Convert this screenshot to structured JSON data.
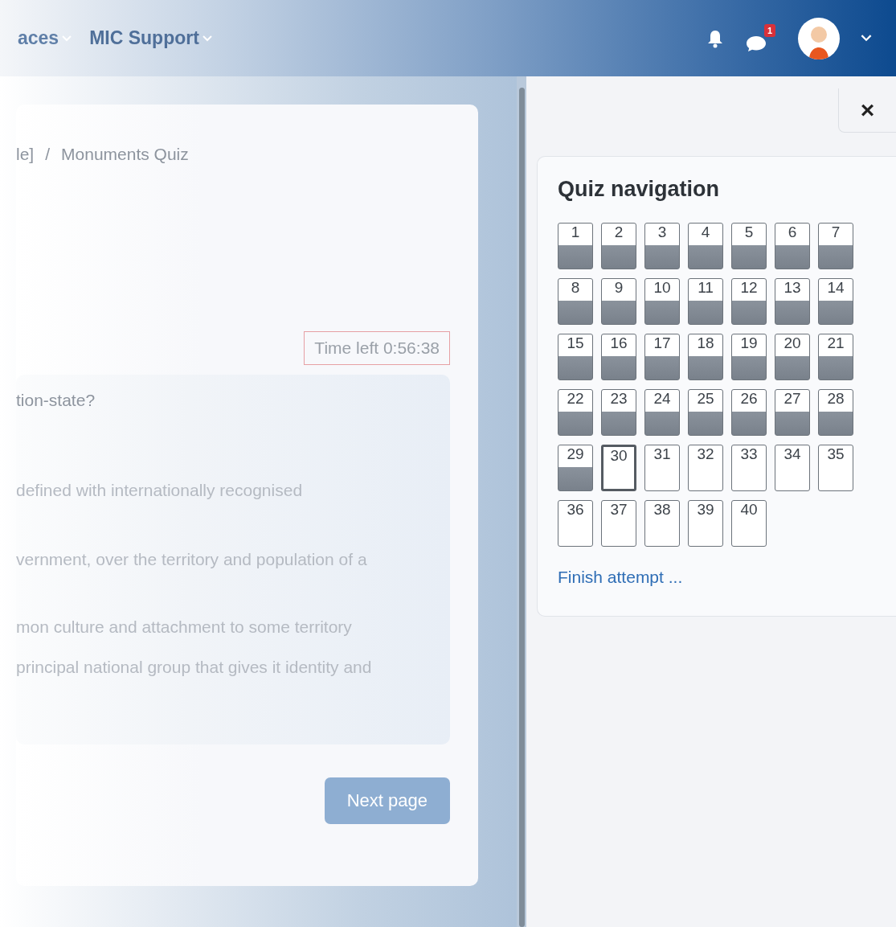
{
  "navbar": {
    "menus": [
      {
        "label": "aces"
      },
      {
        "label": "MIC Support"
      }
    ],
    "message_badge": "1"
  },
  "breadcrumb": {
    "items": [
      "le]",
      "Monuments Quiz"
    ],
    "separator": "/"
  },
  "timer": "Time left 0:56:38",
  "question": {
    "text": "tion-state?",
    "options": [
      "defined with internationally recognised",
      "vernment, over the territory and population of a",
      "mon culture and attachment to some territory",
      "principal national group that gives it identity and"
    ]
  },
  "next_button": "Next page",
  "drawer": {
    "close": "×",
    "title": "Quiz navigation",
    "finish_link": "Finish attempt ...",
    "questions": [
      {
        "label": "1",
        "answered": true,
        "current": false
      },
      {
        "label": "2",
        "answered": true,
        "current": false
      },
      {
        "label": "3",
        "answered": true,
        "current": false
      },
      {
        "label": "4",
        "answered": true,
        "current": false
      },
      {
        "label": "5",
        "answered": true,
        "current": false
      },
      {
        "label": "6",
        "answered": true,
        "current": false
      },
      {
        "label": "7",
        "answered": true,
        "current": false
      },
      {
        "label": "8",
        "answered": true,
        "current": false
      },
      {
        "label": "9",
        "answered": true,
        "current": false
      },
      {
        "label": "10",
        "answered": true,
        "current": false
      },
      {
        "label": "11",
        "answered": true,
        "current": false
      },
      {
        "label": "12",
        "answered": true,
        "current": false
      },
      {
        "label": "13",
        "answered": true,
        "current": false
      },
      {
        "label": "14",
        "answered": true,
        "current": false
      },
      {
        "label": "15",
        "answered": true,
        "current": false
      },
      {
        "label": "16",
        "answered": true,
        "current": false
      },
      {
        "label": "17",
        "answered": true,
        "current": false
      },
      {
        "label": "18",
        "answered": true,
        "current": false
      },
      {
        "label": "19",
        "answered": true,
        "current": false
      },
      {
        "label": "20",
        "answered": true,
        "current": false
      },
      {
        "label": "21",
        "answered": true,
        "current": false
      },
      {
        "label": "22",
        "answered": true,
        "current": false
      },
      {
        "label": "23",
        "answered": true,
        "current": false
      },
      {
        "label": "24",
        "answered": true,
        "current": false
      },
      {
        "label": "25",
        "answered": true,
        "current": false
      },
      {
        "label": "26",
        "answered": true,
        "current": false
      },
      {
        "label": "27",
        "answered": true,
        "current": false
      },
      {
        "label": "28",
        "answered": true,
        "current": false
      },
      {
        "label": "29",
        "answered": true,
        "current": false
      },
      {
        "label": "30",
        "answered": false,
        "current": true
      },
      {
        "label": "31",
        "answered": false,
        "current": false
      },
      {
        "label": "32",
        "answered": false,
        "current": false
      },
      {
        "label": "33",
        "answered": false,
        "current": false
      },
      {
        "label": "34",
        "answered": false,
        "current": false
      },
      {
        "label": "35",
        "answered": false,
        "current": false
      },
      {
        "label": "36",
        "answered": false,
        "current": false
      },
      {
        "label": "37",
        "answered": false,
        "current": false
      },
      {
        "label": "38",
        "answered": false,
        "current": false
      },
      {
        "label": "39",
        "answered": false,
        "current": false
      },
      {
        "label": "40",
        "answered": false,
        "current": false
      }
    ]
  }
}
